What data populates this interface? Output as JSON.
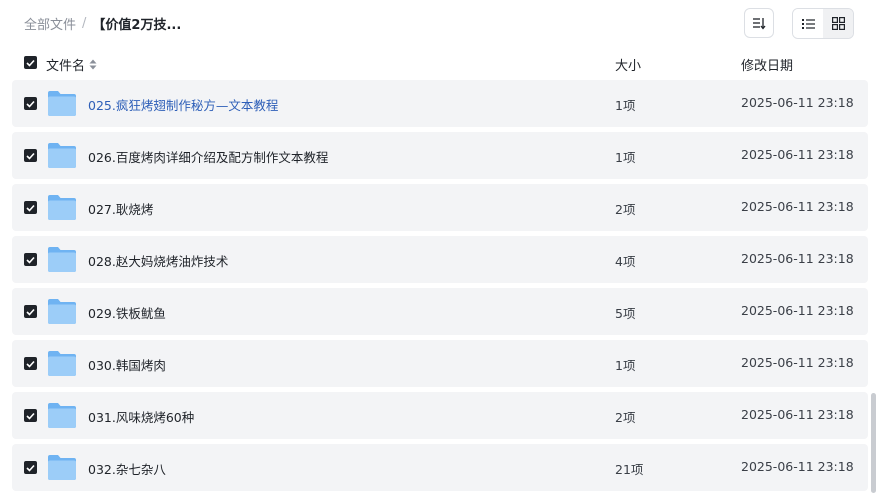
{
  "breadcrumb": {
    "root": "全部文件",
    "separator": "/",
    "current": "【价值2万技..."
  },
  "toolbar": {
    "sort_icon": "sort-icon",
    "list_icon": "list-view-icon",
    "grid_icon": "grid-view-icon"
  },
  "table": {
    "headers": {
      "name": "文件名",
      "size": "大小",
      "modified": "修改日期"
    },
    "rows": [
      {
        "name": "025.疯狂烤翅制作秘方—文本教程",
        "size": "1项",
        "modified": "2025-06-11 23:18"
      },
      {
        "name": "026.百度烤肉详细介绍及配方制作文本教程",
        "size": "1项",
        "modified": "2025-06-11 23:18"
      },
      {
        "name": "027.耿烧烤",
        "size": "2项",
        "modified": "2025-06-11 23:18"
      },
      {
        "name": "028.赵大妈烧烤油炸技术",
        "size": "4项",
        "modified": "2025-06-11 23:18"
      },
      {
        "name": "029.铁板鱿鱼",
        "size": "5项",
        "modified": "2025-06-11 23:18"
      },
      {
        "name": "030.韩国烤肉",
        "size": "1项",
        "modified": "2025-06-11 23:18"
      },
      {
        "name": "031.风味烧烤60种",
        "size": "2项",
        "modified": "2025-06-11 23:18"
      },
      {
        "name": "032.杂七杂八",
        "size": "21项",
        "modified": "2025-06-11 23:18"
      }
    ]
  },
  "colors": {
    "link": "#2e5fb8",
    "row_bg": "#f3f4f6",
    "checkbox": "#1f2329",
    "folder": "#8cc4f7"
  }
}
